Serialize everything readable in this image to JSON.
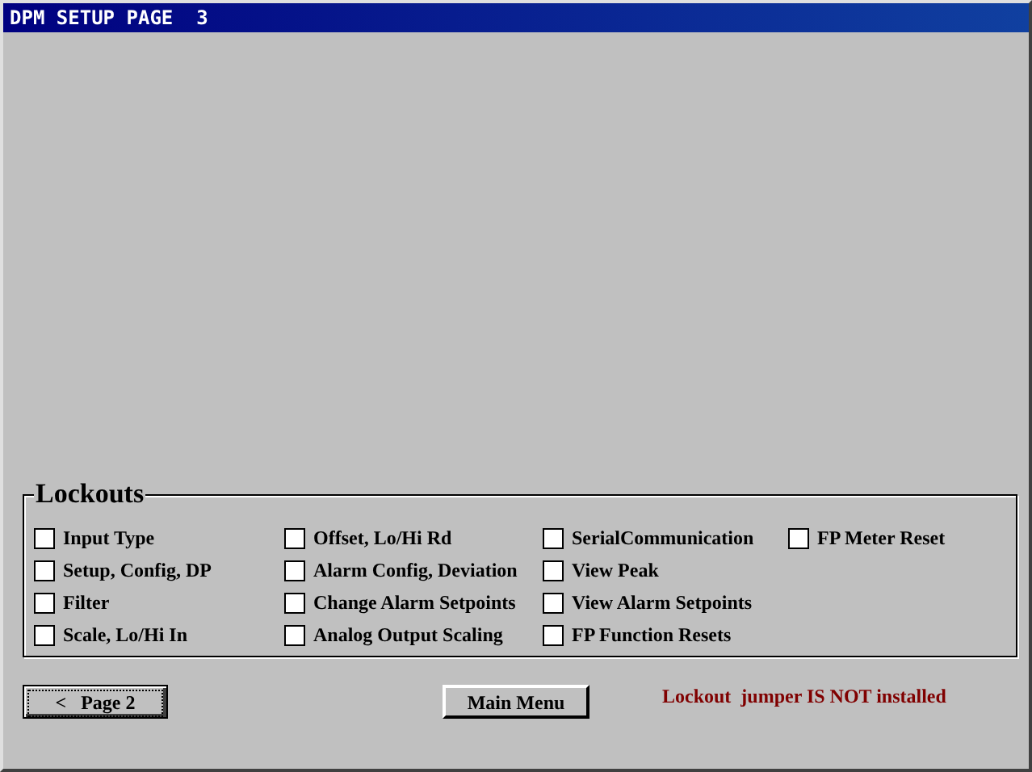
{
  "window": {
    "title": "DPM SETUP PAGE  3"
  },
  "lockouts": {
    "title": "Lockouts",
    "columns": [
      [
        {
          "label": "Input Type",
          "checked": false
        },
        {
          "label": "Setup, Config, DP",
          "checked": false
        },
        {
          "label": "Filter",
          "checked": false
        },
        {
          "label": "Scale, Lo/Hi In",
          "checked": false
        }
      ],
      [
        {
          "label": "Offset, Lo/Hi Rd",
          "checked": false
        },
        {
          "label": "Alarm Config, Deviation",
          "checked": false
        },
        {
          "label": "Change Alarm Setpoints",
          "checked": false
        },
        {
          "label": "Analog Output Scaling",
          "checked": false
        }
      ],
      [
        {
          "label": "SerialCommunication",
          "checked": false
        },
        {
          "label": "View Peak",
          "checked": false
        },
        {
          "label": "View Alarm Setpoints",
          "checked": false
        },
        {
          "label": "FP Function Resets",
          "checked": false
        }
      ],
      [
        {
          "label": "FP Meter Reset",
          "checked": false
        }
      ]
    ]
  },
  "buttons": [
    {
      "label": "<   Page 2",
      "focused": true
    },
    {
      "label": "Main Menu",
      "focused": false
    }
  ],
  "status": "Lockout  jumper IS NOT installed"
}
